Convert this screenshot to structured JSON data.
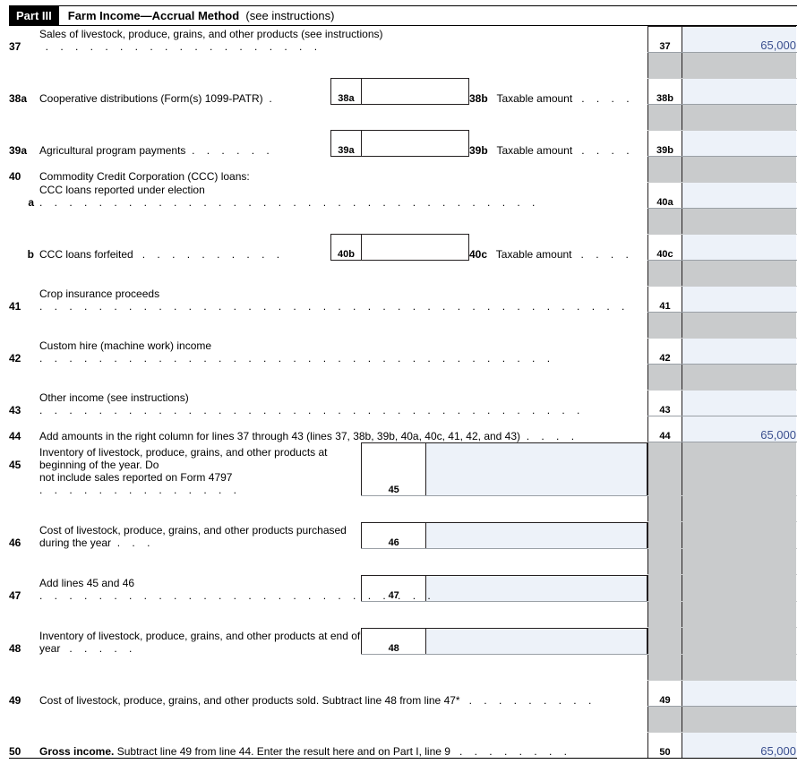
{
  "part": {
    "badge": "Part III",
    "title_strong": "Farm Income—Accrual Method",
    "title_note": "(see instructions)"
  },
  "lines": {
    "l37": {
      "num": "37",
      "text": "Sales of livestock, produce, grains, and other products (see instructions)",
      "rnum": "37",
      "ramt": "65,000"
    },
    "l38a": {
      "num": "38a",
      "text": "Cooperative distributions (Form(s) 1099-PATR)",
      "inlab": "38a",
      "rtnum": "38b",
      "rttext": "Taxable amount",
      "rnum": "38b",
      "ramt": ""
    },
    "l39a": {
      "num": "39a",
      "text": "Agricultural program payments",
      "inlab": "39a",
      "rtnum": "39b",
      "rttext": "Taxable amount",
      "rnum": "39b",
      "ramt": ""
    },
    "l40": {
      "num": "40",
      "text": "Commodity Credit Corporation (CCC) loans:"
    },
    "l40a": {
      "num": "a",
      "text": "CCC loans reported under election",
      "rnum": "40a",
      "ramt": ""
    },
    "l40b": {
      "num": "b",
      "text": "CCC loans forfeited",
      "inlab": "40b",
      "rtnum": "40c",
      "rttext": "Taxable amount",
      "rnum": "40c",
      "ramt": ""
    },
    "l41": {
      "num": "41",
      "text": "Crop insurance proceeds",
      "rnum": "41",
      "ramt": ""
    },
    "l42": {
      "num": "42",
      "text": "Custom hire (machine work) income",
      "rnum": "42",
      "ramt": ""
    },
    "l43": {
      "num": "43",
      "text": "Other income (see instructions)",
      "rnum": "43",
      "ramt": ""
    },
    "l44": {
      "num": "44",
      "text": "Add amounts in the right column for lines 37 through 43 (lines 37, 38b, 39b, 40a, 40c, 41, 42, and 43)",
      "rnum": "44",
      "ramt": "65,000"
    },
    "l45": {
      "num": "45",
      "text1": "Inventory of livestock, produce, grains, and other products at beginning of the year. Do",
      "text2": "not include sales reported on Form 4797",
      "sublab": "45",
      "subval": ""
    },
    "l46": {
      "num": "46",
      "text": "Cost of livestock, produce, grains, and other products purchased during the year",
      "sublab": "46",
      "subval": ""
    },
    "l47": {
      "num": "47",
      "text": "Add lines 45 and 46",
      "sublab": "47",
      "subval": ""
    },
    "l48": {
      "num": "48",
      "text": "Inventory of livestock, produce, grains, and other products at end of year",
      "sublab": "48",
      "subval": ""
    },
    "l49": {
      "num": "49",
      "text": "Cost of livestock, produce, grains, and other products sold. Subtract line 48 from line 47*",
      "rnum": "49",
      "ramt": ""
    },
    "l50": {
      "num": "50",
      "text_strong": "Gross income.",
      "text_rest": " Subtract line 49 from line 44. Enter the result here and on Part I, line 9",
      "rnum": "50",
      "ramt": "65,000"
    }
  }
}
